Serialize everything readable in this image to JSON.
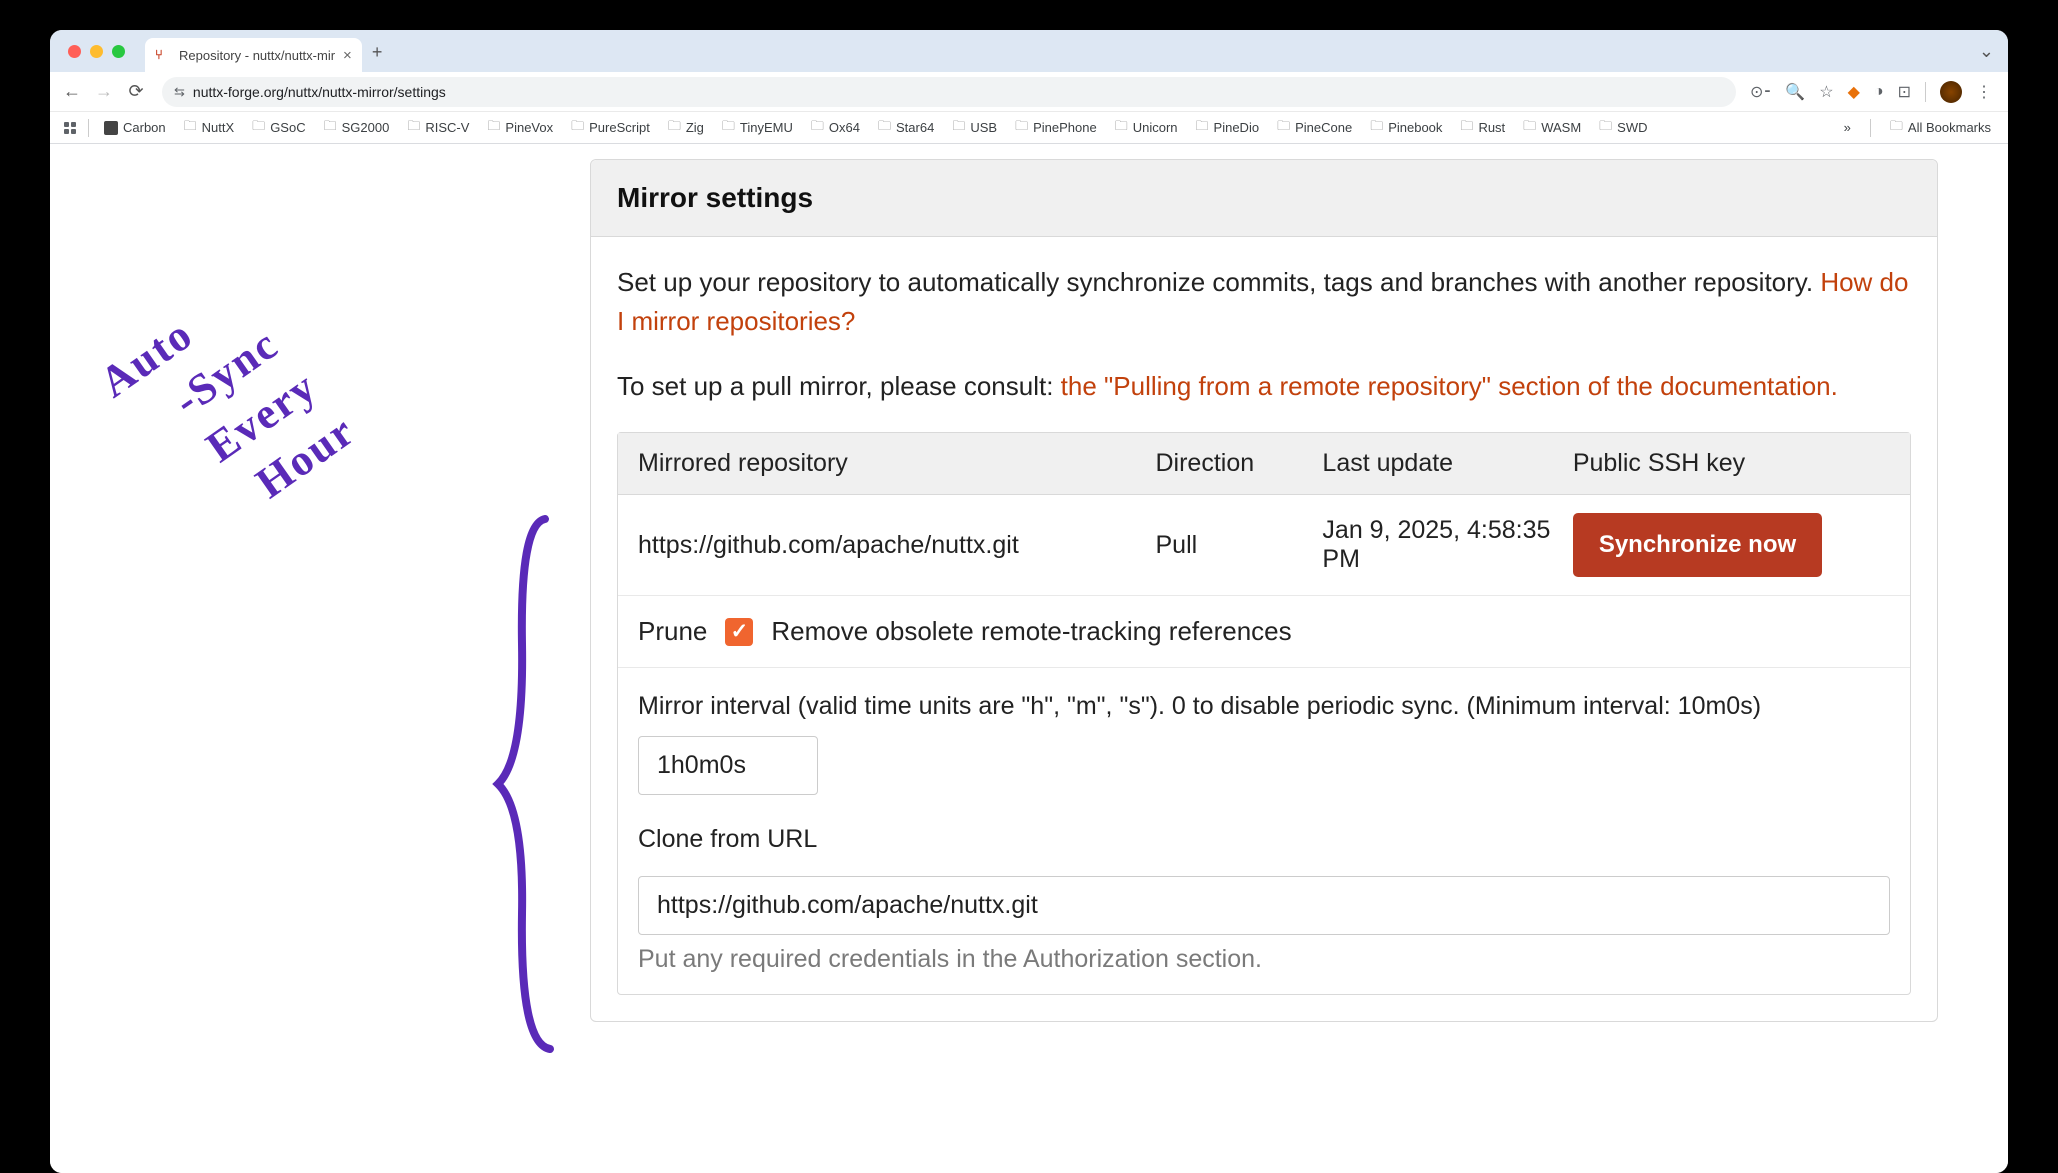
{
  "browser": {
    "tab_title": "Repository - nuttx/nuttx-mir",
    "url": "nuttx-forge.org/nuttx/nuttx-mirror/settings"
  },
  "bookmarks": [
    "Carbon",
    "NuttX",
    "GSoC",
    "SG2000",
    "RISC-V",
    "PineVox",
    "PureScript",
    "Zig",
    "TinyEMU",
    "Ox64",
    "Star64",
    "USB",
    "PinePhone",
    "Unicorn",
    "PineDio",
    "PineCone",
    "Pinebook",
    "Rust",
    "WASM",
    "SWD"
  ],
  "bookmarks_overflow": "»",
  "bookmarks_all": "All Bookmarks",
  "handwriting": {
    "line1": "Auto",
    "line2": "-Sync",
    "line3": "Every",
    "line4": "Hour"
  },
  "panel": {
    "title": "Mirror settings",
    "desc_1": "Set up your repository to automatically synchronize commits, tags and branches with another repository. ",
    "link_1": "How do I mirror repositories?",
    "desc_2_pre": "To set up a pull mirror, please consult: ",
    "link_2": "the \"Pulling from a remote repository\" section of the documentation.",
    "table": {
      "h1": "Mirrored repository",
      "h2": "Direction",
      "h3": "Last update",
      "h4": "Public SSH key",
      "r1_repo": "https://github.com/apache/nuttx.git",
      "r1_dir": "Pull",
      "r1_updated": "Jan 9, 2025, 4:58:35 PM",
      "sync_btn": "Synchronize now"
    },
    "prune_label": "Prune",
    "prune_desc": "Remove obsolete remote-tracking references",
    "interval_label": "Mirror interval (valid time units are \"h\", \"m\", \"s\"). 0 to disable periodic sync. (Minimum interval: 10m0s)",
    "interval_value": "1h0m0s",
    "clone_label": "Clone from URL",
    "clone_value": "https://github.com/apache/nuttx.git",
    "clone_hint": "Put any required credentials in the Authorization section."
  }
}
